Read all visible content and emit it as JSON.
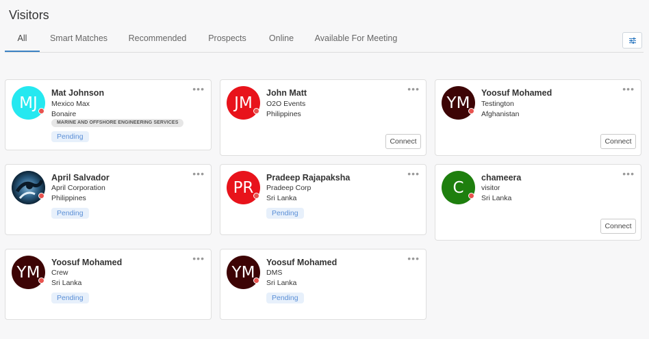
{
  "header": {
    "title": "Visitors"
  },
  "tabs": [
    {
      "label": "All"
    },
    {
      "label": "Smart Matches"
    },
    {
      "label": "Recommended"
    },
    {
      "label": "Prospects"
    },
    {
      "label": "Online"
    },
    {
      "label": "Available For Meeting"
    }
  ],
  "filter_icon": "sliders-icon",
  "more_label": "•••",
  "visitors": [
    {
      "initials": "MJ",
      "avatar_color": "#25e8f0",
      "name": "Mat Johnson",
      "company": "Mexico Max",
      "country": "Bonaire",
      "tag": "MARINE AND OFFSHORE ENGINEERING SERVICES",
      "status": "Pending"
    },
    {
      "initials": "JM",
      "avatar_color": "#e8131b",
      "name": "John Matt",
      "company": "O2O Events",
      "country": "Philippines",
      "action": "Connect"
    },
    {
      "initials": "YM",
      "avatar_color": "#3d0405",
      "name": "Yoosuf Mohamed",
      "company": "Testington",
      "country": "Afghanistan",
      "action": "Connect"
    },
    {
      "initials": "",
      "avatar_color": "#1b3f5c",
      "name": "April Salvador",
      "company": "April Corporation",
      "country": "Philippines",
      "status": "Pending"
    },
    {
      "initials": "PR",
      "avatar_color": "#e8131b",
      "name": "Pradeep Rajapaksha",
      "company": "Pradeep Corp",
      "country": "Sri Lanka",
      "status": "Pending"
    },
    {
      "initials": "C",
      "avatar_color": "#1e7f0e",
      "name": "chameera",
      "company": "visitor",
      "country": "Sri Lanka",
      "action": "Connect"
    },
    {
      "initials": "YM",
      "avatar_color": "#3d0405",
      "name": "Yoosuf Mohamed",
      "company": "Crew",
      "country": "Sri Lanka",
      "status": "Pending"
    },
    {
      "initials": "YM",
      "avatar_color": "#3d0405",
      "name": "Yoosuf Mohamed",
      "company": "DMS",
      "country": "Sri Lanka",
      "status": "Pending"
    }
  ],
  "colors": {
    "accent": "#3b82c4",
    "status_offline": "#e8534f",
    "pending_text": "#5b8fd6"
  }
}
